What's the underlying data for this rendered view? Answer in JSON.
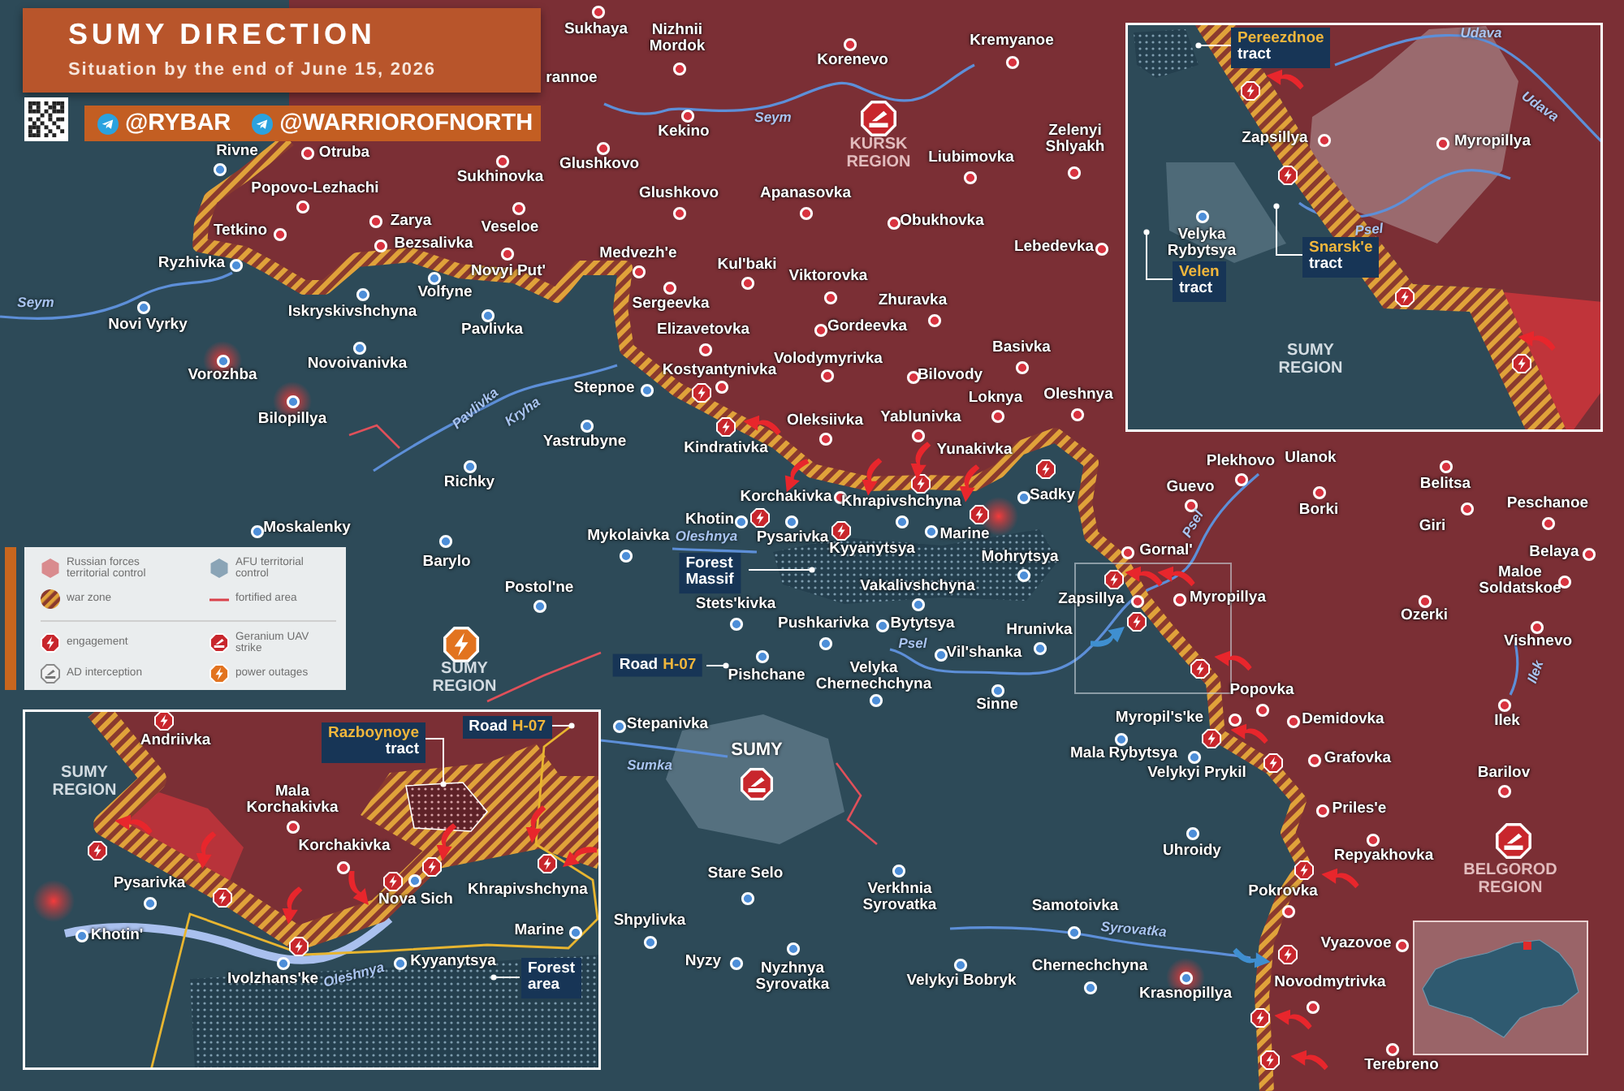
{
  "header": {
    "title": "SUMY DIRECTION",
    "subtitle": "Situation by the end of June 15, 2026",
    "channels": [
      "@RYBAR",
      "@WARRIOROFNORTH"
    ]
  },
  "map": {
    "places": [
      {
        "name": "Sukhaya",
        "color": "#d8323f"
      },
      {
        "name": "Nizhnii Mordok",
        "color": "#d8323f"
      },
      {
        "name": "Kremyanoe",
        "color": "#d8323f"
      },
      {
        "name": "Korenevo",
        "color": "#d8323f"
      },
      {
        "name": "rannoe"
      },
      {
        "name": "Rivne",
        "color": "#4d8ed8"
      },
      {
        "name": "Otruba",
        "color": "#d8323f"
      },
      {
        "name": "Glushkovo",
        "color": "#d8323f"
      },
      {
        "name": "Kekino",
        "color": "#d8323f"
      },
      {
        "name": "Liubimovka",
        "color": "#d8323f"
      },
      {
        "name": "Zelenyi Shlyakh",
        "color": "#d8323f"
      },
      {
        "name": "Sukhinovka",
        "color": "#d8323f"
      },
      {
        "name": "Popovo-Lezhachi",
        "color": "#d8323f"
      },
      {
        "name": "Glushkovo",
        "color": "#d8323f"
      },
      {
        "name": "Apanasovka",
        "color": "#d8323f"
      },
      {
        "name": "Tetkino",
        "color": "#d8323f"
      },
      {
        "name": "Zarya",
        "color": "#d8323f"
      },
      {
        "name": "Veseloe",
        "color": "#d8323f"
      },
      {
        "name": "Obukhovka",
        "color": "#d8323f"
      },
      {
        "name": "Bezsalivka",
        "color": "#d8323f"
      },
      {
        "name": "Medvezh'e",
        "color": "#d8323f"
      },
      {
        "name": "Lebedevka",
        "color": "#d8323f"
      },
      {
        "name": "Ryzhivka",
        "color": "#4d8ed8"
      },
      {
        "name": "Novyi Put'",
        "color": "#d8323f"
      },
      {
        "name": "Kul'baki",
        "color": "#d8323f"
      },
      {
        "name": "Viktorovka",
        "color": "#d8323f"
      },
      {
        "name": "Iskryskivshchyna",
        "color": "#4d8ed8"
      },
      {
        "name": "Volfyne",
        "color": "#4d8ed8"
      },
      {
        "name": "Sergeevka",
        "color": "#d8323f"
      },
      {
        "name": "Zhuravka",
        "color": "#d8323f"
      },
      {
        "name": "Novi Vyrky",
        "color": "#4d8ed8"
      },
      {
        "name": "Pavlivka",
        "color": "#4d8ed8"
      },
      {
        "name": "Elizavetovka",
        "color": "#d8323f"
      },
      {
        "name": "Gordeevka",
        "color": "#d8323f"
      },
      {
        "name": "Basivka",
        "color": "#d8323f"
      },
      {
        "name": "Vorozhba",
        "color": "#4d8ed8"
      },
      {
        "name": "Novoivanivka",
        "color": "#4d8ed8"
      },
      {
        "name": "Kostyantynivka",
        "color": "#d8323f"
      },
      {
        "name": "Volodymyrivka",
        "color": "#d8323f"
      },
      {
        "name": "Bilovody",
        "color": "#d8323f"
      },
      {
        "name": "Stepnoe",
        "color": "#4d8ed8"
      },
      {
        "name": "Loknya",
        "color": "#d8323f"
      },
      {
        "name": "Oleshnya",
        "color": "#d8323f"
      },
      {
        "name": "Bilopillya",
        "color": "#4d8ed8"
      },
      {
        "name": "Oleksiivka",
        "color": "#d8323f"
      },
      {
        "name": "Yablunivka",
        "color": "#d8323f"
      },
      {
        "name": "Yastrubyne",
        "color": "#4d8ed8"
      },
      {
        "name": "Kindrativka"
      },
      {
        "name": "Yunakivka"
      },
      {
        "name": "Plekhovo",
        "color": "#d8323f"
      },
      {
        "name": "Ulanok"
      },
      {
        "name": "Richky",
        "color": "#4d8ed8"
      },
      {
        "name": "Korchakivka",
        "color": "#d8323f"
      },
      {
        "name": "Khrapivshchyna",
        "color": "#4d8ed8"
      },
      {
        "name": "Sadky",
        "color": "#4d8ed8"
      },
      {
        "name": "Guevo",
        "color": "#d8323f"
      },
      {
        "name": "Borki",
        "color": "#d8323f"
      },
      {
        "name": "Belitsa",
        "color": "#d8323f"
      },
      {
        "name": "Peschanoe",
        "color": "#d8323f"
      },
      {
        "name": "Moskalenky",
        "color": "#4d8ed8"
      },
      {
        "name": "Mykolaivka",
        "color": "#4d8ed8"
      },
      {
        "name": "Khotin",
        "color": "#4d8ed8"
      },
      {
        "name": "Pysarivka",
        "color": "#4d8ed8"
      },
      {
        "name": "Marine",
        "color": "#4d8ed8"
      },
      {
        "name": "Giri",
        "color": "#d8323f"
      },
      {
        "name": "Barylo",
        "color": "#4d8ed8"
      },
      {
        "name": "Kyyanytsya"
      },
      {
        "name": "Mohrytsya",
        "color": "#4d8ed8"
      },
      {
        "name": "Gornal'",
        "color": "#d8323f"
      },
      {
        "name": "Belaya",
        "color": "#d8323f"
      },
      {
        "name": "Postol'ne",
        "color": "#4d8ed8"
      },
      {
        "name": "Vakalivshchyna",
        "color": "#4d8ed8"
      },
      {
        "name": "Maloe Soldatskoe",
        "color": "#d8323f"
      },
      {
        "name": "Stets'kivka",
        "color": "#4d8ed8"
      },
      {
        "name": "Zapsillya",
        "color": "#d8323f"
      },
      {
        "name": "Myropillya",
        "color": "#d8323f"
      },
      {
        "name": "Pushkarivka",
        "color": "#4d8ed8"
      },
      {
        "name": "Bytytsya",
        "color": "#4d8ed8"
      },
      {
        "name": "Hrunivka",
        "color": "#4d8ed8"
      },
      {
        "name": "Ozerki",
        "color": "#d8323f"
      },
      {
        "name": "Vishnevo",
        "color": "#d8323f"
      },
      {
        "name": "Vil'shanka",
        "color": "#4d8ed8"
      },
      {
        "name": "Pishchane",
        "color": "#4d8ed8"
      },
      {
        "name": "Velyka Chernechchyna",
        "color": "#4d8ed8"
      },
      {
        "name": "Popovka",
        "color": "#d8323f"
      },
      {
        "name": "Sinne",
        "color": "#4d8ed8"
      },
      {
        "name": "Stepanivka",
        "color": "#4d8ed8"
      },
      {
        "name": "Myropil's'ke",
        "color": "#d8323f"
      },
      {
        "name": "Demidovka",
        "color": "#d8323f"
      },
      {
        "name": "Ilek",
        "color": "#d8323f"
      },
      {
        "name": "Mala Rybytsya",
        "color": "#4d8ed8"
      },
      {
        "name": "Grafovka",
        "color": "#d8323f"
      },
      {
        "name": "Velykyi Prykil",
        "color": "#4d8ed8"
      },
      {
        "name": "Barilov",
        "color": "#d8323f"
      },
      {
        "name": "Priles'e",
        "color": "#d8323f"
      },
      {
        "name": "Uhroidy",
        "color": "#4d8ed8"
      },
      {
        "name": "Repyakhovka",
        "color": "#d8323f"
      },
      {
        "name": "Stare Selo",
        "color": "#4d8ed8"
      },
      {
        "name": "Verkhnia Syrovatka",
        "color": "#4d8ed8"
      },
      {
        "name": "Samotoivka",
        "color": "#4d8ed8"
      },
      {
        "name": "Pokrovka",
        "color": "#d8323f"
      },
      {
        "name": "Shpylivka",
        "color": "#4d8ed8"
      },
      {
        "name": "Vyazovoe",
        "color": "#d8323f"
      },
      {
        "name": "Nyzy",
        "color": "#4d8ed8"
      },
      {
        "name": "Nyzhnya Syrovatka",
        "color": "#4d8ed8"
      },
      {
        "name": "Velykyi Bobryk",
        "color": "#4d8ed8"
      },
      {
        "name": "Chernechchyna",
        "color": "#4d8ed8"
      },
      {
        "name": "Novodmytrivka",
        "color": "#d8323f"
      },
      {
        "name": "Krasnopillya",
        "color": "#4d8ed8"
      },
      {
        "name": "Terebreno",
        "color": "#d8323f"
      }
    ],
    "rivers": [
      "Seym",
      "Seym",
      "Pavlivka",
      "Kryha",
      "Oleshnya",
      "Psel",
      "Psel",
      "Sumka",
      "Syrovatka",
      "Ilek"
    ],
    "markers": [
      {
        "label": "KURSK REGION",
        "kind": "uav_strike"
      },
      {
        "label": "SUMY REGION",
        "kind": "power_outage"
      },
      {
        "label": "SUMY",
        "kind": "uav_strike"
      },
      {
        "label": "BELGOROD REGION",
        "kind": "uav_strike"
      }
    ],
    "callouts": [
      {
        "text": "Forest Massif"
      },
      {
        "text": "Road",
        "code": "H-07"
      }
    ]
  },
  "inset_north": {
    "tracts": [
      {
        "name": "Pereezdnoe",
        "word": "tract"
      },
      {
        "name": "Snarsk'e",
        "word": "tract"
      },
      {
        "name": "Velen",
        "word": "tract"
      }
    ],
    "rivers": [
      "Udava",
      "Udava",
      "Psel"
    ],
    "places": [
      {
        "name": "Zapsillya",
        "color": "#d8323f"
      },
      {
        "name": "Myropillya",
        "color": "#d8323f"
      },
      {
        "name": "Velyka Rybytsya",
        "color": "#4d8ed8"
      }
    ],
    "region": "SUMY REGION"
  },
  "legend": {
    "items": [
      {
        "label": "Russian forces territorial control",
        "kind": "russian_control"
      },
      {
        "label": "AFU territorial control",
        "kind": "afu_control"
      },
      {
        "label": "war zone",
        "kind": "war_zone"
      },
      {
        "label": "fortified area",
        "kind": "fortified"
      },
      {
        "label": "engagement",
        "kind": "engagement"
      },
      {
        "label": "Geranium UAV strike",
        "kind": "uav_strike"
      },
      {
        "label": "AD interception",
        "kind": "ad_interception"
      },
      {
        "label": "power outages",
        "kind": "power_outage"
      }
    ]
  },
  "inset_south": {
    "road": {
      "text": "Road",
      "code": "H-07"
    },
    "tracts": [
      {
        "name": "Razboynoye",
        "word": "tract"
      }
    ],
    "places": [
      {
        "name": "Andriivka"
      },
      {
        "name": "Mala Korchakivka",
        "color": "#d8323f"
      },
      {
        "name": "Korchakivka",
        "color": "#d8323f"
      },
      {
        "name": "Pysarivka",
        "color": "#4d8ed8"
      },
      {
        "name": "Nova Sich",
        "color": "#4d8ed8"
      },
      {
        "name": "Khrapivshchyna"
      },
      {
        "name": "Khotin'",
        "color": "#4d8ed8"
      },
      {
        "name": "Marine",
        "color": "#4d8ed8"
      },
      {
        "name": "Ivolzhans'ke",
        "color": "#4d8ed8"
      },
      {
        "name": "Kyyanytsya",
        "color": "#4d8ed8"
      }
    ],
    "rivers": [
      "Oleshnya"
    ],
    "region": "SUMY REGION",
    "forest": "Forest area"
  }
}
